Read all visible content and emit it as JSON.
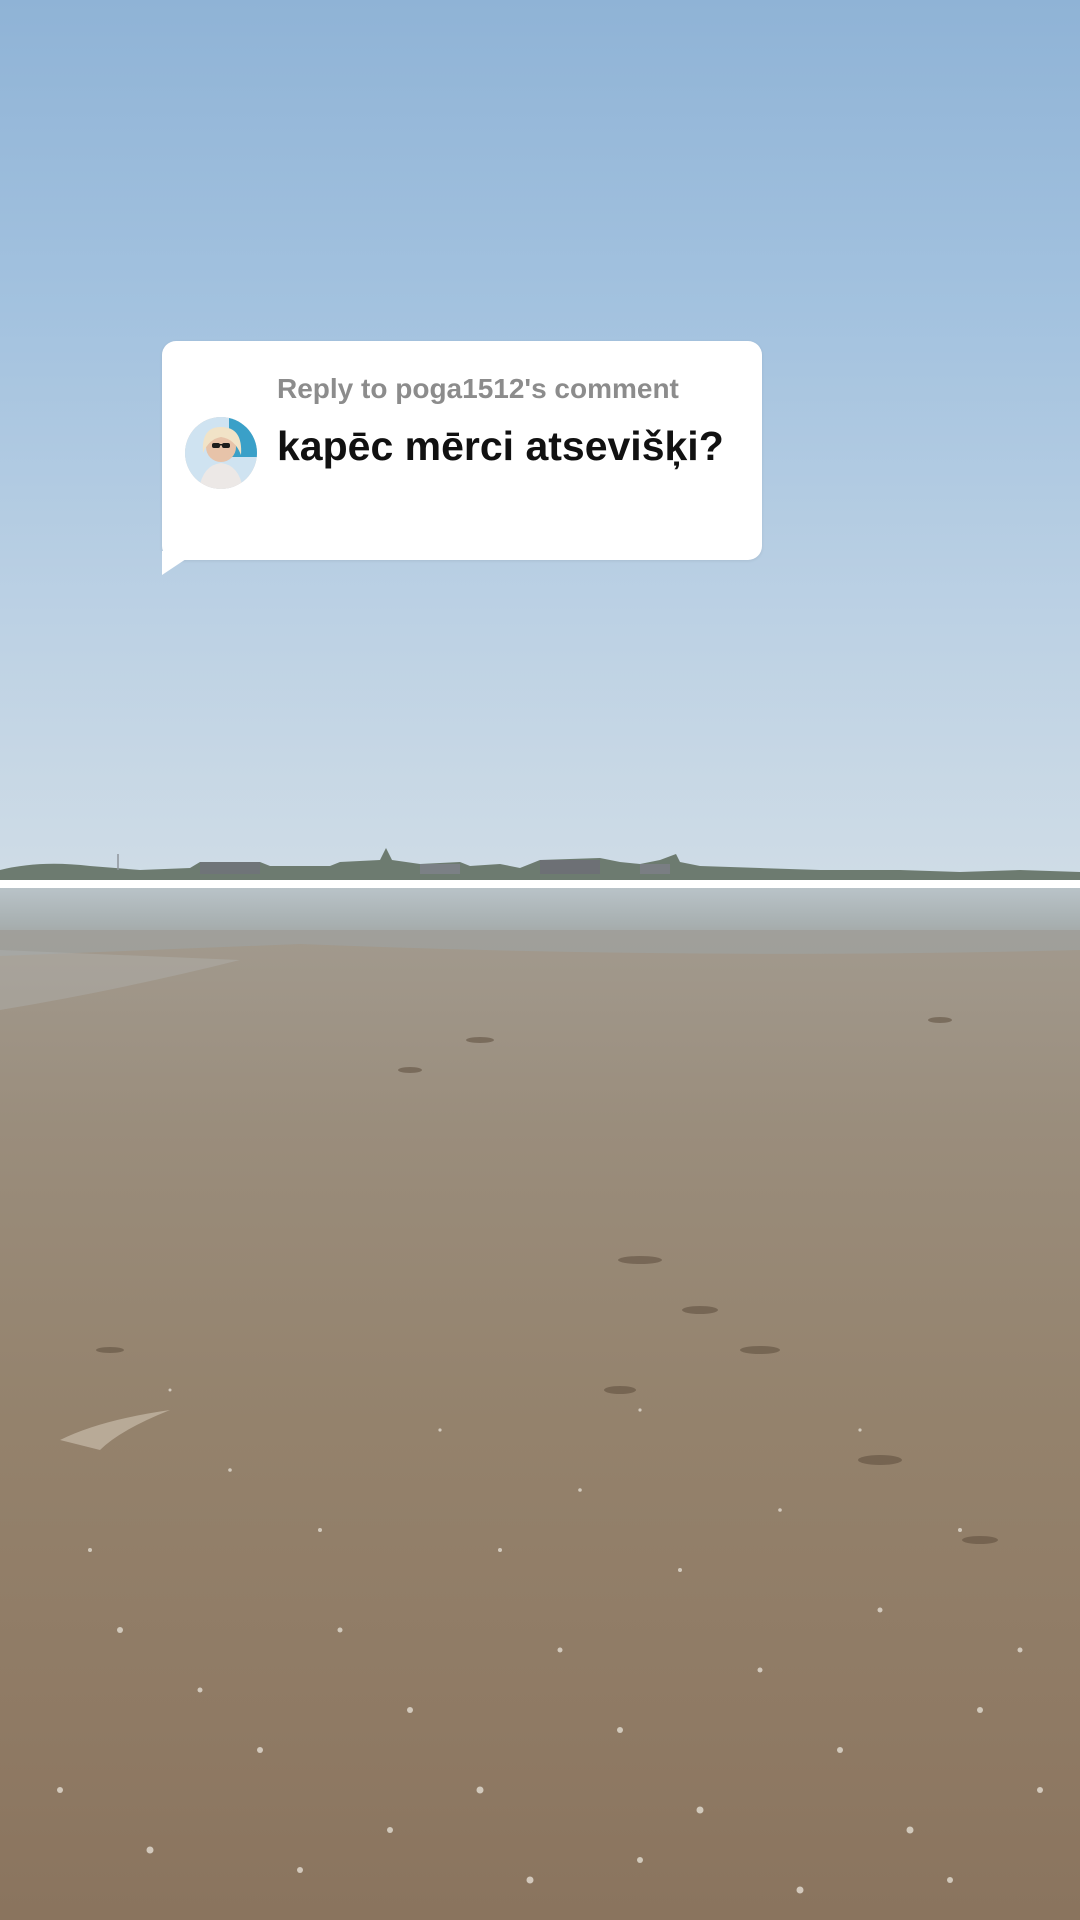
{
  "reply_sticker": {
    "label": "Reply to poga1512's comment",
    "comment": "kapēc mērci atsevišķi?",
    "avatar_icon": "user-avatar"
  },
  "colors": {
    "bubble_bg": "#ffffff",
    "label_gray": "#8c8c8c",
    "comment_text": "#111111"
  }
}
